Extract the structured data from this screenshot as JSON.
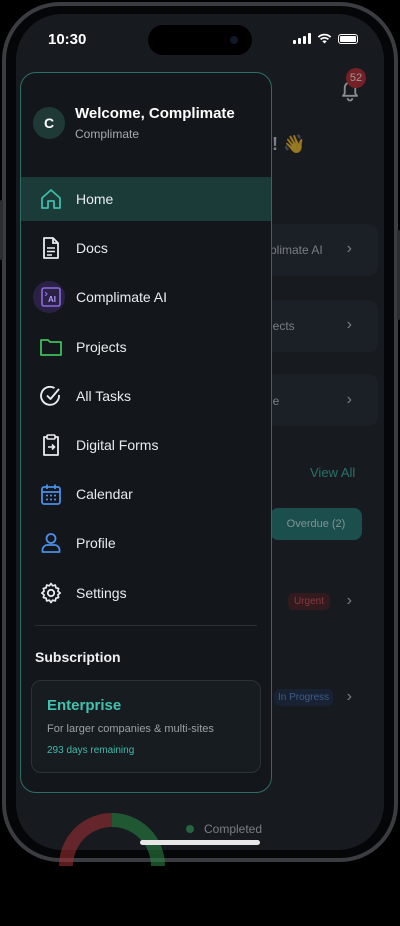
{
  "status_bar": {
    "time": "10:30"
  },
  "background": {
    "notification_count": "52",
    "greeting_tail": "! 👋",
    "cards": [
      {
        "label": "plimate AI"
      },
      {
        "label": "jects"
      },
      {
        "label": "le"
      }
    ],
    "view_all": "View All",
    "filter_overdue": "Overdue (2)",
    "task_badges": {
      "urgent": "Urgent",
      "in_progress": "In Progress"
    },
    "legend_completed": "Completed",
    "chevron": "›"
  },
  "drawer": {
    "avatar_initial": "C",
    "welcome": "Welcome, Complimate",
    "organization": "Complimate",
    "nav": [
      {
        "label": "Home",
        "icon": "home-icon",
        "active": true
      },
      {
        "label": "Docs",
        "icon": "document-icon"
      },
      {
        "label": "Complimate AI",
        "icon": "ai-icon"
      },
      {
        "label": "Projects",
        "icon": "folder-icon"
      },
      {
        "label": "All Tasks",
        "icon": "check-circle-icon"
      },
      {
        "label": "Digital Forms",
        "icon": "clipboard-icon"
      },
      {
        "label": "Calendar",
        "icon": "calendar-icon"
      },
      {
        "label": "Profile",
        "icon": "user-icon"
      },
      {
        "label": "Settings",
        "icon": "gear-icon"
      }
    ],
    "subscription": {
      "title": "Subscription",
      "plan": "Enterprise",
      "description": "For larger companies & multi-sites",
      "remaining": "293 days remaining"
    }
  },
  "colors": {
    "accent": "#3fbba9",
    "drawer_border": "#2e6d66",
    "active_bg": "#1b3b39",
    "urgent": "#e0555d",
    "in_progress": "#5b8fe0",
    "badge": "#c2252b"
  }
}
